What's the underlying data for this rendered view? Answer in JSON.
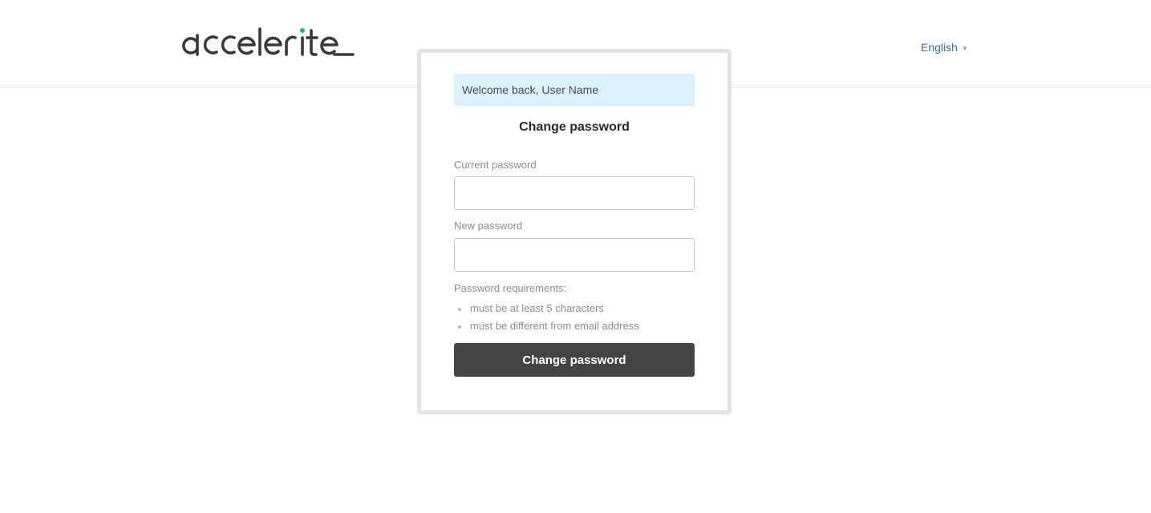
{
  "header": {
    "logo_text": "accelerite",
    "language": "English"
  },
  "card": {
    "welcome": "Welcome back, User Name",
    "title": "Change password",
    "current_password_label": "Current password",
    "current_password_value": "",
    "new_password_label": "New password",
    "new_password_value": "",
    "requirements_title": "Password requirements:",
    "requirements": [
      "must be at least 5 characters",
      "must be different from email address"
    ],
    "submit_label": "Change password"
  },
  "colors": {
    "welcome_bg": "#dbf2fd",
    "button_bg": "#444444",
    "link": "#2f6fa8",
    "logo_accent": "#1fb39a",
    "logo_text": "#3a3a3a"
  },
  "icons": {
    "language_caret": "caret-down-icon"
  }
}
